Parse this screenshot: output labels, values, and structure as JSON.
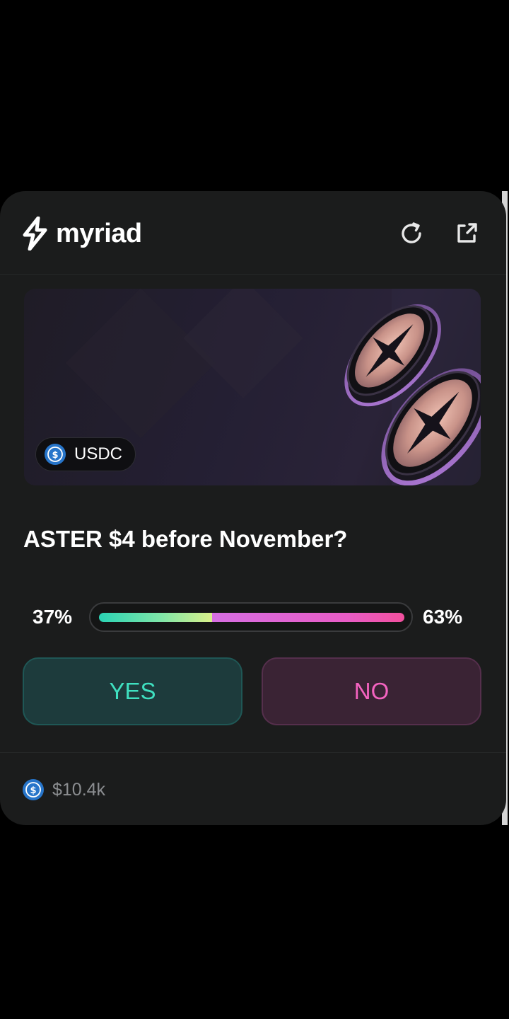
{
  "brand": {
    "name": "myriad"
  },
  "header": {
    "refresh_icon": "refresh-icon",
    "external_icon": "external-link-icon"
  },
  "market": {
    "token_badge": "USDC",
    "question": "ASTER $4 before November?",
    "odds": {
      "yes_label": "37%",
      "no_label": "63%",
      "yes_fraction": 0.37
    },
    "buttons": {
      "yes": "YES",
      "no": "NO"
    },
    "volume": "$10.4k"
  },
  "colors": {
    "card_bg": "#1b1c1c",
    "yes_accent": "#3fe0c0",
    "no_accent": "#f463c0",
    "usdc_blue": "#2775ca"
  }
}
